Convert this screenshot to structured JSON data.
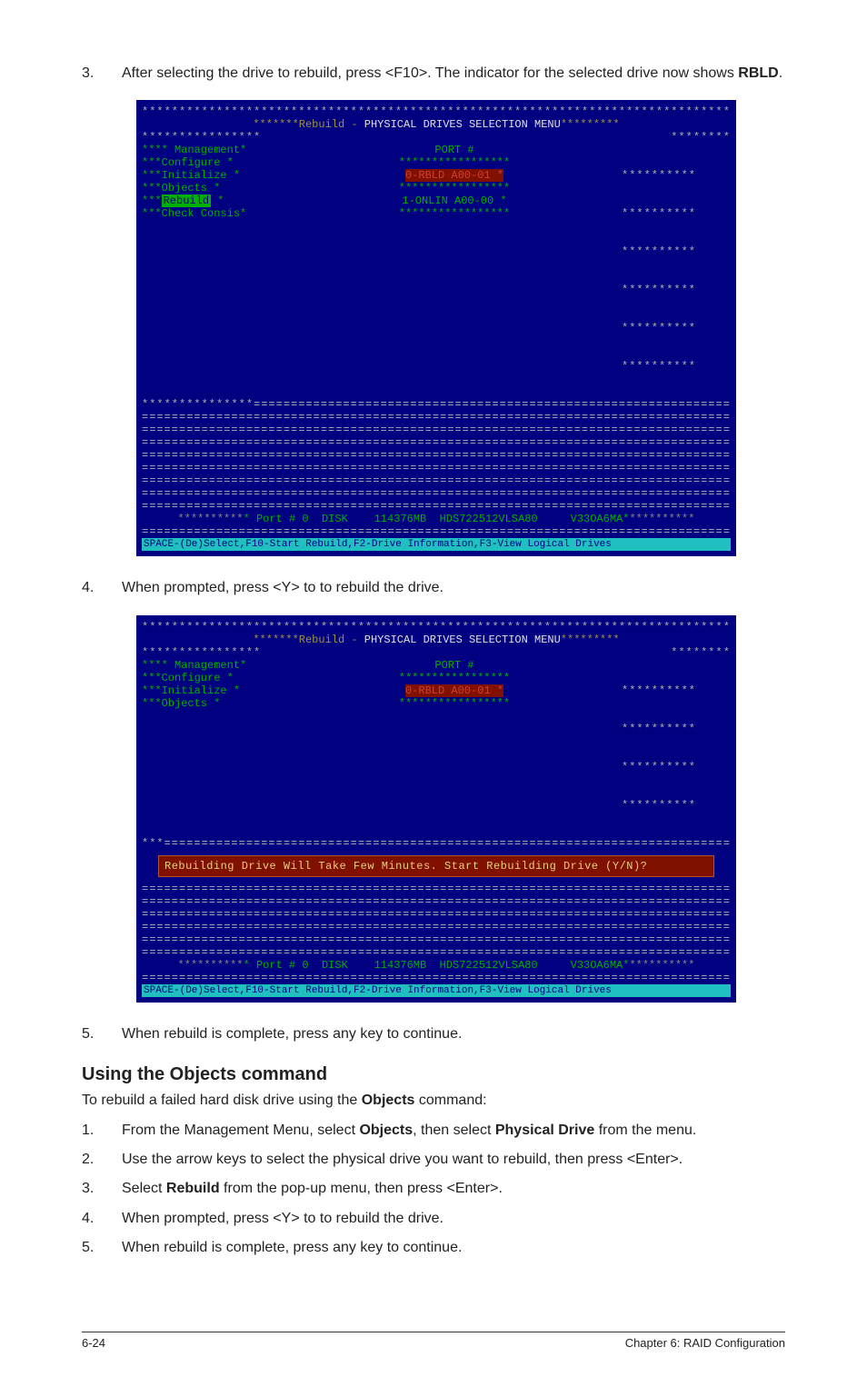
{
  "step3": {
    "num": "3.",
    "text_a": "After selecting the drive to rebuild, press <F10>. The indicator for the selected drive now shows ",
    "bold": "RBLD",
    "text_b": "."
  },
  "bios1": {
    "title_pre": "*******Rebuild - ",
    "title_main": "PHYSICAL DRIVES SELECTION MENU",
    "title_post": "*********",
    "menu": {
      "m1": "**** Management*",
      "m2": "***Configure   *",
      "m3": "***Initialize  *",
      "m4": "***Objects     *",
      "m5": "Rebuild",
      "m6": "***Check Consis*"
    },
    "port_label": "PORT #",
    "slot0": "0-RBLD  A00-01  *",
    "slot1": "1-ONLIN A00-00  *",
    "footer": "* Port # 0  DISK    114376MB  HDS722512VLSA80     V33OA6MA*",
    "help": "SPACE-(De)Select,F10-Start Rebuild,F2-Drive Information,F3-View Logical Drives"
  },
  "step4": {
    "num": "4.",
    "text": "When prompted, press <Y> to to rebuild the drive."
  },
  "bios2": {
    "title_pre": "*******Rebuild - ",
    "title_main": "PHYSICAL DRIVES SELECTION MENU",
    "title_post": "*********",
    "menu": {
      "m1": "**** Management*",
      "m2": "***Configure   *",
      "m3": "***Initialize  *",
      "m4": "***Objects     *"
    },
    "port_label": "PORT #",
    "slot0": "0-RBLD  A00-01  *",
    "prompt": "Rebuilding Drive Will Take Few Minutes. Start Rebuilding Drive (Y/N)?",
    "footer": "* Port # 0  DISK    114376MB  HDS722512VLSA80     V33OA6MA*",
    "help": "SPACE-(De)Select,F10-Start Rebuild,F2-Drive Information,F3-View Logical Drives"
  },
  "step5": {
    "num": "5.",
    "text": "When rebuild is complete, press any key to continue."
  },
  "section": {
    "heading": "Using the Objects command",
    "intro_a": "To rebuild a failed hard disk drive using the ",
    "intro_bold": "Objects",
    "intro_b": " command:"
  },
  "steps_b": {
    "s1": {
      "num": "1.",
      "a": "From the Management Menu, select ",
      "b1": "Objects",
      "c": ", then select ",
      "b2": "Physical Drive",
      "d": " from the menu."
    },
    "s2": {
      "num": "2.",
      "text": "Use the arrow keys to select the physical drive you want to rebuild, then press <Enter>."
    },
    "s3": {
      "num": "3.",
      "a": "Select ",
      "b1": "Rebuild",
      "c": " from the pop-up menu, then press <Enter>."
    },
    "s4": {
      "num": "4.",
      "text": "When prompted, press <Y> to to rebuild the drive."
    },
    "s5": {
      "num": "5.",
      "text": "When rebuild is complete, press any key to continue."
    }
  },
  "footer": {
    "left": "6-24",
    "right": "Chapter 6: RAID Configuration"
  }
}
